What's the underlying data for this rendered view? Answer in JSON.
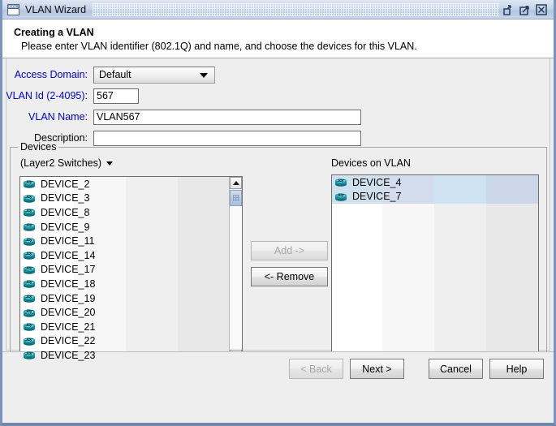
{
  "window": {
    "title": "VLAN Wizard",
    "icon": "window-icon",
    "controls": [
      {
        "name": "minimize-button",
        "icon": "minimize-icon"
      },
      {
        "name": "maximize-button",
        "icon": "maximize-icon"
      },
      {
        "name": "close-button",
        "icon": "close-icon"
      }
    ]
  },
  "header": {
    "title": "Creating a VLAN",
    "subtitle": "Please enter VLAN identifier (802.1Q) and name, and choose the devices for this VLAN."
  },
  "form": {
    "access_domain": {
      "label": "Access Domain:",
      "value": "Default",
      "label_color": "#0000cc"
    },
    "vlan_id": {
      "label": "VLAN Id (2-4095):",
      "value": "567",
      "placeholder": "",
      "label_color": "#0000cc"
    },
    "vlan_name": {
      "label": "VLAN Name:",
      "value": "VLAN567",
      "placeholder": "",
      "label_color": "#0000cc"
    },
    "description": {
      "label": "Description:",
      "value": "",
      "placeholder": "",
      "label_color": "#000000"
    }
  },
  "devices": {
    "group_label": "Devices",
    "filter_label": "(Layer2 Switches)",
    "available": [
      {
        "name": "DEVICE_2",
        "icon": "switch-icon",
        "selected": false
      },
      {
        "name": "DEVICE_3",
        "icon": "switch-icon",
        "selected": false
      },
      {
        "name": "DEVICE_8",
        "icon": "switch-icon",
        "selected": false
      },
      {
        "name": "DEVICE_9",
        "icon": "switch-icon",
        "selected": false
      },
      {
        "name": "DEVICE_11",
        "icon": "switch-icon",
        "selected": false
      },
      {
        "name": "DEVICE_14",
        "icon": "switch-icon",
        "selected": false
      },
      {
        "name": "DEVICE_17",
        "icon": "switch-icon",
        "selected": false
      },
      {
        "name": "DEVICE_18",
        "icon": "switch-icon",
        "selected": false
      },
      {
        "name": "DEVICE_19",
        "icon": "switch-icon",
        "selected": false
      },
      {
        "name": "DEVICE_20",
        "icon": "switch-icon",
        "selected": false
      },
      {
        "name": "DEVICE_21",
        "icon": "switch-icon",
        "selected": false
      },
      {
        "name": "DEVICE_22",
        "icon": "switch-icon",
        "selected": false
      },
      {
        "name": "DEVICE_23",
        "icon": "switch-icon",
        "selected": false
      }
    ],
    "on_vlan_label": "Devices on VLAN",
    "on_vlan": [
      {
        "name": "DEVICE_4",
        "icon": "switch-icon",
        "selected": true
      },
      {
        "name": "DEVICE_7",
        "icon": "switch-icon",
        "selected": true
      }
    ],
    "add_button": {
      "label": "Add ->",
      "disabled": true
    },
    "remove_button": {
      "label": "<- Remove",
      "disabled": false
    }
  },
  "footer": {
    "back": {
      "label": "< Back",
      "disabled": true
    },
    "next": {
      "label": "Next >",
      "disabled": false
    },
    "cancel": {
      "label": "Cancel",
      "disabled": false
    },
    "help": {
      "label": "Help",
      "disabled": false
    }
  },
  "colors": {
    "selection": "#cfe0ef",
    "label_blue": "#0000cc",
    "titlebar": "#c6d4e8",
    "device_icon": "#1b8b96",
    "panel": "#eeeeee"
  }
}
